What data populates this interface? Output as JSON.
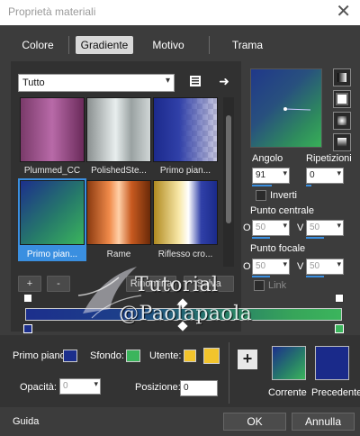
{
  "window": {
    "title": "Proprietà materiali",
    "close_glyph": "✕"
  },
  "tabs": [
    {
      "label": "Colore"
    },
    {
      "label": "Gradiente"
    },
    {
      "label": "Motivo"
    },
    {
      "label": "Trama"
    }
  ],
  "library": {
    "category": "Tutto",
    "items": [
      {
        "label": "Plummed_CC"
      },
      {
        "label": "PolishedSte..."
      },
      {
        "label": "Primo pian..."
      },
      {
        "label": "Primo pian..."
      },
      {
        "label": "Rame"
      },
      {
        "label": "Riflesso cro..."
      }
    ],
    "selected_index": 3
  },
  "controls": {
    "angle_label": "Angolo",
    "angle_value": "91",
    "repeats_label": "Ripetizioni",
    "repeats_value": "0",
    "invert_label": "Inverti",
    "center_label": "Punto centrale",
    "center_o": "O",
    "center_o_value": "50",
    "center_v": "V",
    "center_v_value": "50",
    "focal_label": "Punto focale",
    "focal_o": "O",
    "focal_o_value": "50",
    "focal_v": "V",
    "focal_v_value": "50",
    "link_label": "Link"
  },
  "editor_buttons": {
    "add": "+",
    "remove": "-",
    "rename": "Rinomina",
    "save": "Salva"
  },
  "stops": {
    "foreground_label": "Primo piano:",
    "background_label": "Sfondo:",
    "user_label": "Utente:",
    "opacity_label": "Opacità:",
    "opacity_value": "0",
    "position_label": "Posizione:",
    "position_value": "0"
  },
  "swatches": {
    "add": "+",
    "current_label": "Corrente",
    "previous_label": "Precedente"
  },
  "footer": {
    "help": "Guida",
    "ok": "OK",
    "cancel": "Annulla"
  },
  "watermark": {
    "line1": "Tutorial",
    "line2": "@Paolapaola"
  },
  "colors": {
    "accent": "#3a8fe0",
    "gradient_start": "#1c2f8c",
    "gradient_end": "#3bb55c",
    "user_color": "#f2c42c",
    "previous_color": "#1a2a8a"
  }
}
